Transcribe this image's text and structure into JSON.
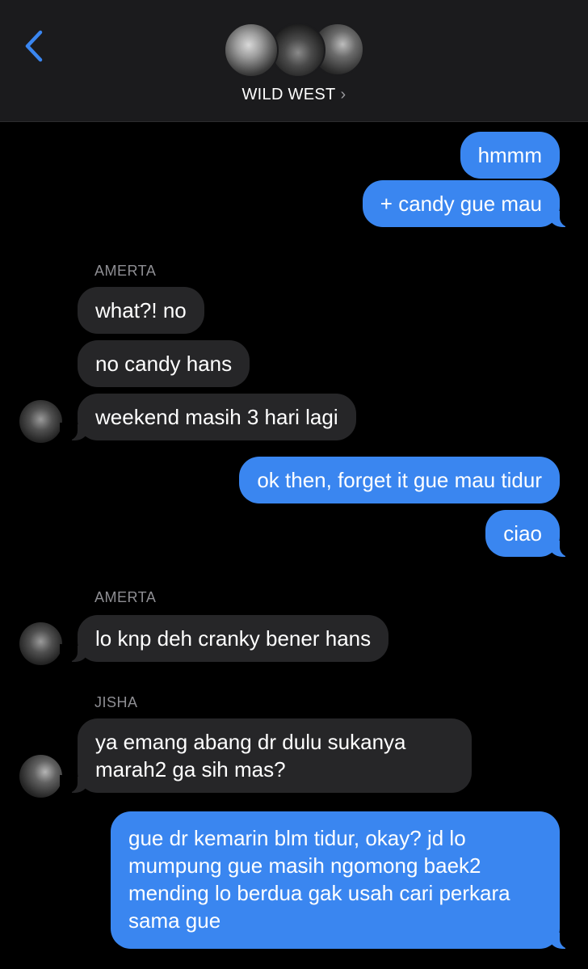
{
  "header": {
    "group_name": "WILD WEST",
    "chevron": "›"
  },
  "icons": {
    "back": "chevron-left-icon",
    "avatar": "avatar"
  },
  "colors": {
    "accent": "#3a86f0",
    "incoming_bubble": "#262628",
    "header_bg": "#1b1b1d",
    "sender_label": "#8e8e93"
  },
  "messages": [
    {
      "from": "me",
      "text": "hmmm"
    },
    {
      "from": "me",
      "text": "+ candy gue mau"
    },
    {
      "sender_label": "AMERTA"
    },
    {
      "from": "AMERTA",
      "text": "what?! no"
    },
    {
      "from": "AMERTA",
      "text": "no candy hans"
    },
    {
      "from": "AMERTA",
      "text": "weekend masih 3 hari lagi"
    },
    {
      "from": "me",
      "text": "ok then, forget it gue mau tidur"
    },
    {
      "from": "me",
      "text": "ciao"
    },
    {
      "sender_label": "AMERTA"
    },
    {
      "from": "AMERTA",
      "text": "lo knp deh cranky bener hans"
    },
    {
      "sender_label": "JISHA"
    },
    {
      "from": "JISHA",
      "text": "ya emang abang dr dulu sukanya marah2 ga sih mas?"
    },
    {
      "from": "me",
      "text": "gue dr kemarin blm tidur, okay? jd lo mumpung gue masih ngomong baek2 mending lo berdua gak usah cari perkara sama gue"
    }
  ]
}
